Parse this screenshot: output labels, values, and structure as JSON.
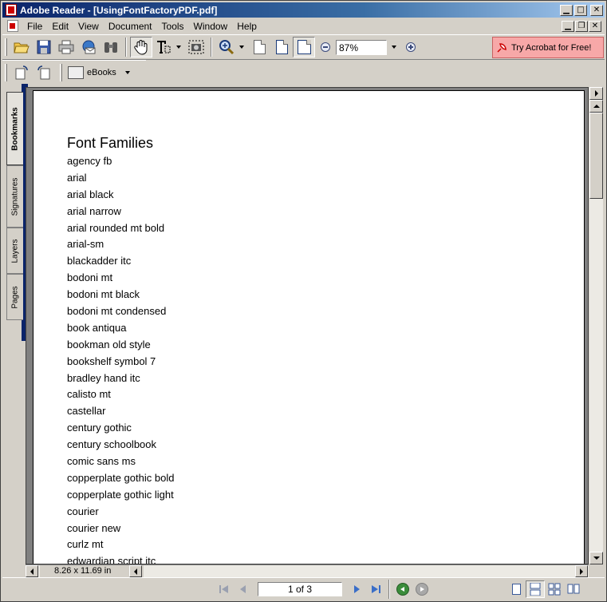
{
  "window": {
    "title": "Adobe Reader - [UsingFontFactoryPDF.pdf]"
  },
  "menu": {
    "items": [
      "File",
      "Edit",
      "View",
      "Document",
      "Tools",
      "Window",
      "Help"
    ]
  },
  "toolbar": {
    "zoom_value": "87%",
    "try_acrobat_label": "Try Acrobat for Free!",
    "ebooks_label": "eBooks"
  },
  "sidepanel": {
    "tabs": [
      "Bookmarks",
      "Signatures",
      "Layers",
      "Pages"
    ]
  },
  "document": {
    "heading": "Font Families",
    "fonts": [
      "agency fb",
      "arial",
      "arial black",
      "arial narrow",
      "arial rounded mt bold",
      "arial-sm",
      "blackadder itc",
      "bodoni mt",
      "bodoni mt black",
      "bodoni mt condensed",
      "book antiqua",
      "bookman old style",
      "bookshelf symbol 7",
      "bradley hand itc",
      "calisto mt",
      "castellar",
      "century gothic",
      "century schoolbook",
      "comic sans ms",
      "copperplate gothic bold",
      "copperplate gothic light",
      "courier",
      "courier new",
      "curlz mt",
      "edwardian script itc"
    ]
  },
  "status": {
    "page_size": "8.26 x 11.69 in",
    "page_indicator": "1 of 3"
  },
  "colors": {
    "titlebar_start": "#0a246a",
    "try_acrobat_bg": "#f7a8a8",
    "chrome": "#d4d0c8"
  }
}
